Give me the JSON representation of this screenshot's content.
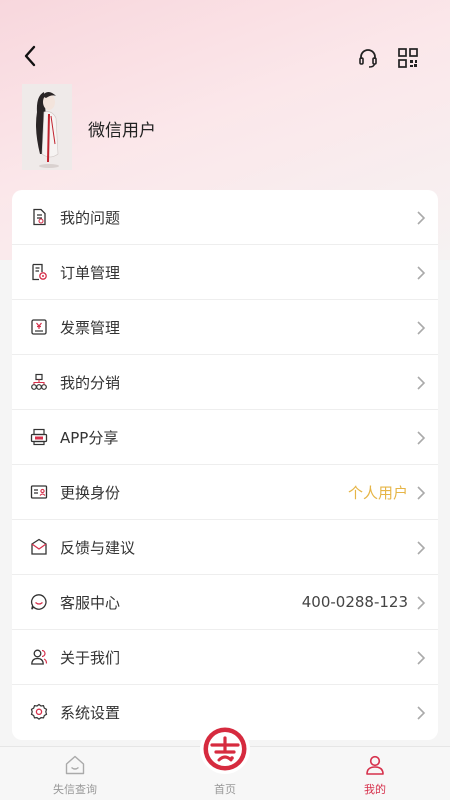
{
  "header": {
    "back_icon": "chevron-left-icon",
    "support_icon": "headset-icon",
    "qr_icon": "qr-code-icon"
  },
  "profile": {
    "username": "微信用户",
    "avatar_icon": "avatar-illustration"
  },
  "menu": {
    "items": [
      {
        "label": "我的问题",
        "value": "",
        "icon": "question-doc-icon"
      },
      {
        "label": "订单管理",
        "value": "",
        "icon": "order-doc-icon"
      },
      {
        "label": "发票管理",
        "value": "",
        "icon": "invoice-icon"
      },
      {
        "label": "我的分销",
        "value": "",
        "icon": "distribution-icon"
      },
      {
        "label": "APP分享",
        "value": "",
        "icon": "share-device-icon"
      },
      {
        "label": "更换身份",
        "value": "个人用户",
        "icon": "id-card-icon"
      },
      {
        "label": "反馈与建议",
        "value": "",
        "icon": "envelope-icon"
      },
      {
        "label": "客服中心",
        "value": "400-0288-123",
        "icon": "chat-bubble-icon"
      },
      {
        "label": "关于我们",
        "value": "",
        "icon": "users-icon"
      },
      {
        "label": "系统设置",
        "value": "",
        "icon": "gear-icon"
      }
    ]
  },
  "tabbar": {
    "tabs": [
      {
        "label": "失信查询",
        "icon": "house-icon"
      },
      {
        "label": "首页",
        "icon": "brand-logo-icon"
      },
      {
        "label": "我的",
        "icon": "person-icon"
      }
    ],
    "active_color": "#d6314c",
    "inactive_color": "#999999"
  },
  "colors": {
    "accent": "#d6314c",
    "value_highlight": "#e6b547"
  }
}
